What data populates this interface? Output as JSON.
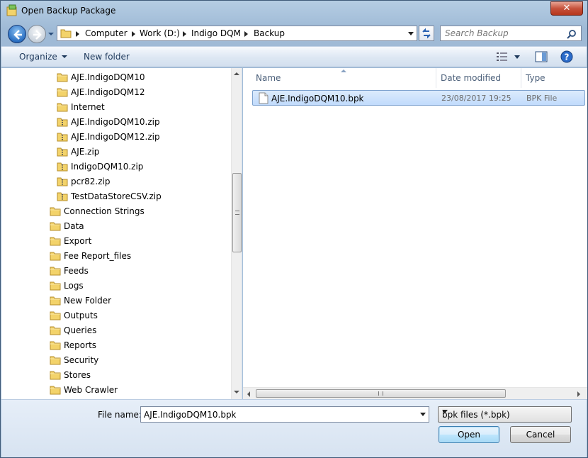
{
  "window": {
    "title": "Open Backup Package"
  },
  "address": {
    "crumbs": [
      "Computer",
      "Work (D:)",
      "Indigo DQM",
      "Backup"
    ]
  },
  "search": {
    "placeholder": "Search Backup"
  },
  "toolbar": {
    "organize_label": "Organize",
    "new_folder_label": "New folder"
  },
  "nav_items": [
    {
      "label": "AJE.IndigoDQM10",
      "icon": "folder-icon",
      "level": 2
    },
    {
      "label": "AJE.IndigoDQM12",
      "icon": "folder-icon",
      "level": 2
    },
    {
      "label": "Internet",
      "icon": "folder-icon",
      "level": 2
    },
    {
      "label": "AJE.IndigoDQM10.zip",
      "icon": "zip-folder-icon",
      "level": 2
    },
    {
      "label": "AJE.IndigoDQM12.zip",
      "icon": "zip-folder-icon",
      "level": 2
    },
    {
      "label": "AJE.zip",
      "icon": "zip-folder-icon",
      "level": 2
    },
    {
      "label": "IndigoDQM10.zip",
      "icon": "zip-folder-icon",
      "level": 2
    },
    {
      "label": "pcr82.zip",
      "icon": "zip-folder-icon",
      "level": 2
    },
    {
      "label": "TestDataStoreCSV.zip",
      "icon": "zip-folder-icon",
      "level": 2
    },
    {
      "label": "Connection Strings",
      "icon": "folder-icon",
      "level": 1
    },
    {
      "label": "Data",
      "icon": "folder-icon",
      "level": 1
    },
    {
      "label": "Export",
      "icon": "folder-icon",
      "level": 1
    },
    {
      "label": "Fee Report_files",
      "icon": "folder-icon",
      "level": 1
    },
    {
      "label": "Feeds",
      "icon": "folder-icon",
      "level": 1
    },
    {
      "label": "Logs",
      "icon": "folder-icon",
      "level": 1
    },
    {
      "label": "New Folder",
      "icon": "folder-icon",
      "level": 1
    },
    {
      "label": "Outputs",
      "icon": "folder-icon",
      "level": 1
    },
    {
      "label": "Queries",
      "icon": "folder-icon",
      "level": 1
    },
    {
      "label": "Reports",
      "icon": "folder-icon",
      "level": 1
    },
    {
      "label": "Security",
      "icon": "folder-icon",
      "level": 1
    },
    {
      "label": "Stores",
      "icon": "folder-icon",
      "level": 1
    },
    {
      "label": "Web Crawler",
      "icon": "folder-icon",
      "level": 1
    }
  ],
  "columns": {
    "name": "Name",
    "date": "Date modified",
    "type": "Type"
  },
  "files": [
    {
      "name": "AJE.IndigoDQM10.bpk",
      "date": "23/08/2017 19:25",
      "type": "BPK File"
    }
  ],
  "bottom": {
    "file_name_label": "File name:",
    "file_name_value": "AJE.IndigoDQM10.bpk",
    "filter_value": "bpk files (*.bpk)",
    "open_label": "Open",
    "cancel_label": "Cancel"
  }
}
